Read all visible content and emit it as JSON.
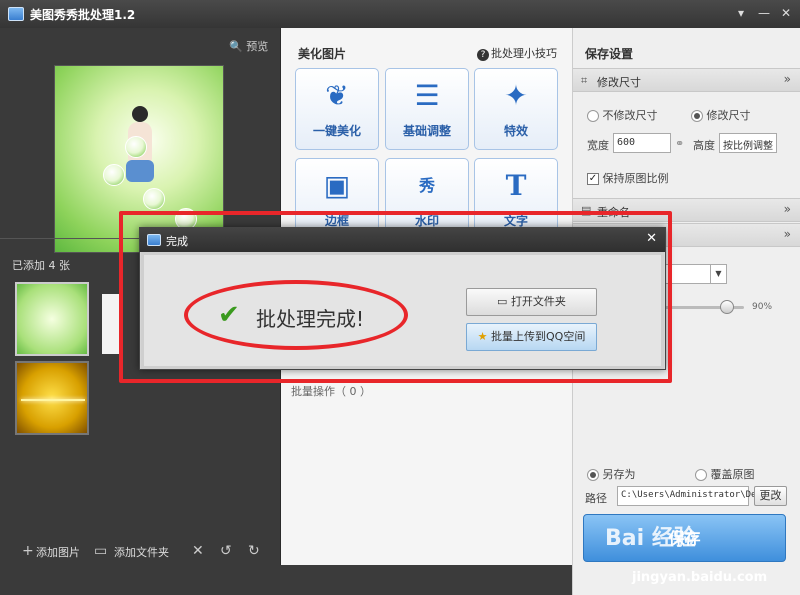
{
  "titlebar": {
    "title": "美图秀秀批处理1.2",
    "menu_icon": "menu-icon",
    "min_icon": "minimize-icon",
    "close_icon": "close-icon"
  },
  "left": {
    "preview_label": "预览",
    "added_count": "已添加 4 张",
    "bottom": {
      "add_images": "添加图片",
      "add_folder": "添加文件夹"
    }
  },
  "middle": {
    "title": "美化图片",
    "tips": "批处理小技巧",
    "tools": [
      {
        "label": "一键美化",
        "icon": "tulip-icon"
      },
      {
        "label": "基础调整",
        "icon": "sliders-icon"
      },
      {
        "label": "特效",
        "icon": "magic-wand-icon"
      },
      {
        "label": "边框",
        "icon": "frame-icon"
      },
      {
        "label": "水印",
        "icon": "watermark-icon",
        "glyph": "秀"
      },
      {
        "label": "文字",
        "icon": "text-icon",
        "glyph": "T"
      }
    ],
    "batch_ops": "批量操作（ 0 ）"
  },
  "right": {
    "title": "保存设置",
    "resize": {
      "header": "修改尺寸",
      "opt_no": "不修改尺寸",
      "opt_yes": "修改尺寸",
      "width_label": "宽度",
      "width_value": "600",
      "height_label": "高度",
      "height_value": "按比例调整",
      "keep_ratio": "保持原图比例"
    },
    "rename_header": "重命名",
    "quality_value": "90%",
    "save_as": "另存为",
    "overwrite": "覆盖原图",
    "path_label": "路径",
    "path_value": "C:\\Users\\Administrator\\De",
    "change_btn": "更改",
    "save_btn": "保存"
  },
  "dialog": {
    "title": "完成",
    "message": "批处理完成!",
    "open_folder": "打开文件夹",
    "upload_qq": "批量上传到QQ空间"
  },
  "watermark": {
    "brand": "Bai 经验",
    "url": "jingyan.baidu.com"
  },
  "colors": {
    "annotation_red": "#e8262a",
    "accent_blue": "#3f8fdc"
  }
}
